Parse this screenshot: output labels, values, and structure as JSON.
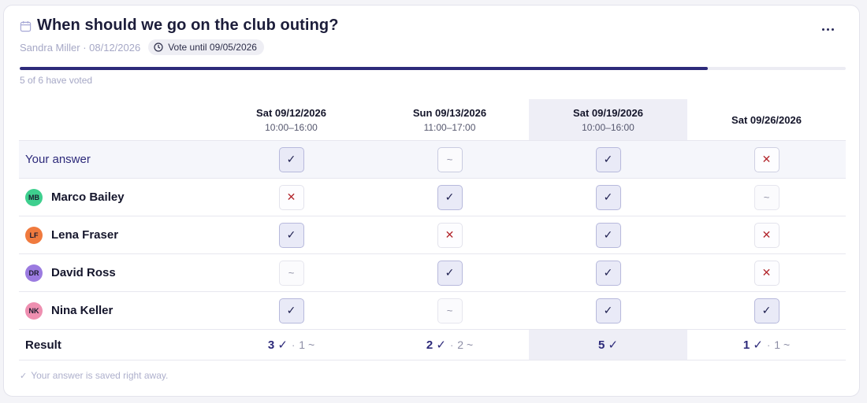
{
  "poll": {
    "title": "When should we go on the club outing?",
    "meta": "Sandra Miller · 08/12/2026",
    "vote_until": "Vote until 09/05/2026",
    "voted_text": "5 of 6 have voted",
    "progress_fraction": 0.833,
    "footer_note": "Your answer is saved right away.",
    "footer_check": "✓"
  },
  "columns": [
    {
      "date": "Sat 09/12/2026",
      "time": "10:00–16:00",
      "highlight": false
    },
    {
      "date": "Sun 09/13/2026",
      "time": "11:00–17:00",
      "highlight": false
    },
    {
      "date": "Sat 09/19/2026",
      "time": "10:00–16:00",
      "highlight": true
    },
    {
      "date": "Sat 09/26/2026",
      "time": "",
      "highlight": false
    }
  ],
  "your_answer": {
    "label": "Your answer",
    "answers": [
      "yes",
      "maybe",
      "yes",
      "no"
    ]
  },
  "participants": [
    {
      "initials": "MB",
      "name": "Marco Bailey",
      "color": "#3ecf8e",
      "answers": [
        "no",
        "yes",
        "yes",
        "maybe"
      ]
    },
    {
      "initials": "LF",
      "name": "Lena Fraser",
      "color": "#f07a3e",
      "answers": [
        "yes",
        "no",
        "yes",
        "no"
      ]
    },
    {
      "initials": "DR",
      "name": "David Ross",
      "color": "#9b7be0",
      "answers": [
        "maybe",
        "yes",
        "yes",
        "no"
      ]
    },
    {
      "initials": "NK",
      "name": "Nina Keller",
      "color": "#ee8fb0",
      "answers": [
        "yes",
        "maybe",
        "yes",
        "yes"
      ]
    }
  ],
  "result": {
    "label": "Result",
    "cells": [
      {
        "yes": "3 ✓",
        "maybe": "1 ~"
      },
      {
        "yes": "2 ✓",
        "maybe": "2 ~"
      },
      {
        "yes": "5 ✓",
        "maybe": ""
      },
      {
        "yes": "1 ✓",
        "maybe": "1 ~"
      }
    ],
    "separator": "·"
  },
  "symbols": {
    "yes": "✓",
    "no": "✕",
    "maybe": "~"
  },
  "icons": {
    "calendar": "calendar-icon",
    "clock": "clock-icon",
    "more": "more-options-icon"
  }
}
